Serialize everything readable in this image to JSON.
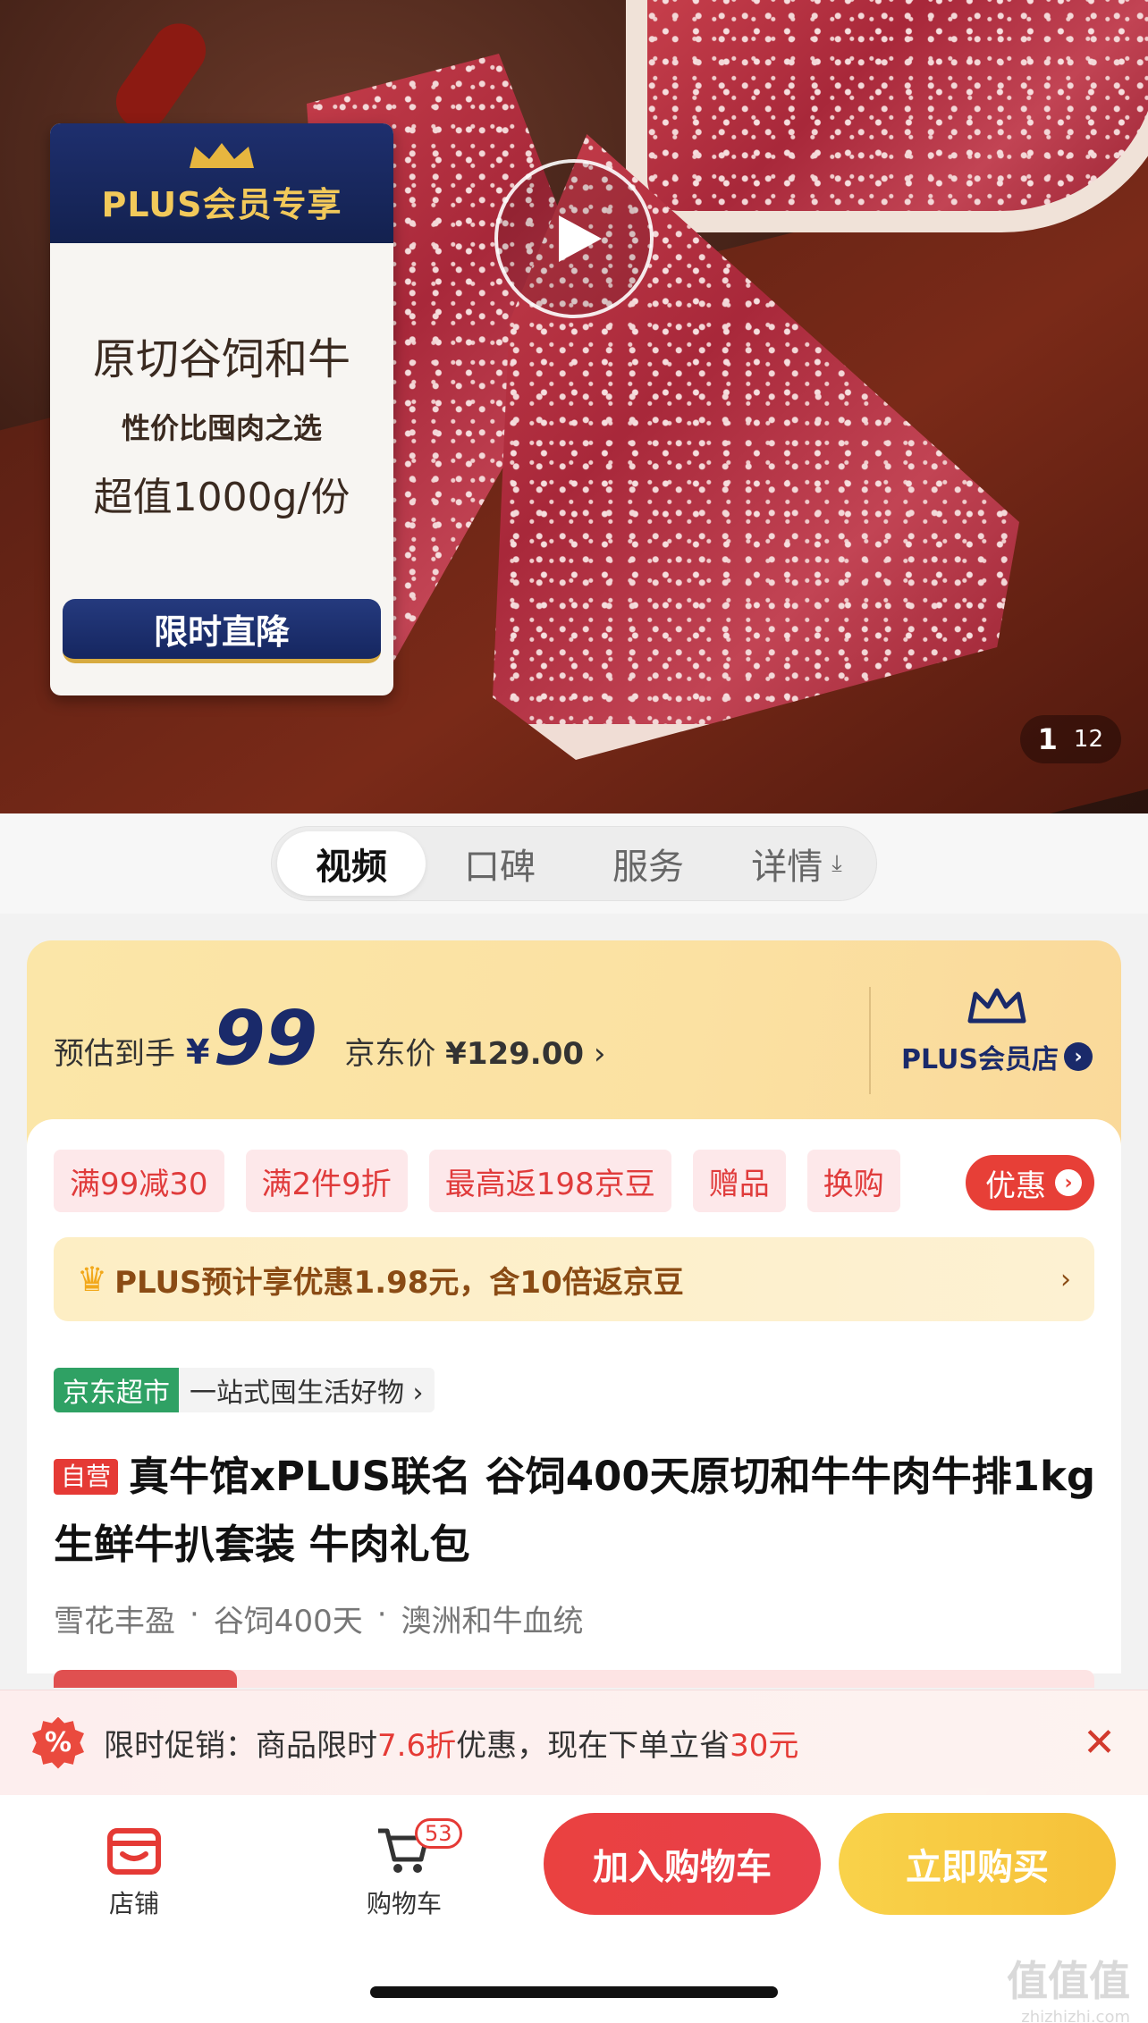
{
  "hero": {
    "promo_card": {
      "header": "PLUS会员专享",
      "title": "原切谷饲和牛",
      "subtitle": "性价比囤肉之选",
      "amount": "超值1000g/份",
      "button": "限时直降"
    },
    "counter": {
      "current": "1",
      "total": "12"
    }
  },
  "tabs": [
    {
      "label": "视频",
      "active": true
    },
    {
      "label": "口碑"
    },
    {
      "label": "服务"
    },
    {
      "label": "详情",
      "icon": "download-icon"
    }
  ],
  "price": {
    "estimate_label": "预估到手",
    "currency": "¥",
    "estimate_value": "99",
    "jd_label": "京东价",
    "jd_value": "¥129.00",
    "jd_chevron": "›",
    "plus_store": "PLUS会员店"
  },
  "tags": [
    "满99减30",
    "满2件9折",
    "最高返198京豆",
    "赠品",
    "换购"
  ],
  "youhui": "优惠",
  "plus_bar": {
    "text": "PLUS预计享优惠1.98元，含10倍返京豆",
    "chevron": "›"
  },
  "category": {
    "badge": "京东超市",
    "text": "一站式囤生活好物 ›"
  },
  "product": {
    "badge": "自营",
    "title": "真牛馆xPLUS联名 谷饲400天原切和牛牛肉牛排1kg 生鲜牛扒套装 牛肉礼包",
    "features": [
      "雪花丰盈",
      "谷饲400天",
      "澳洲和牛血统"
    ]
  },
  "promo_bar": {
    "icon": "%",
    "prefix": "限时促销：商品限时",
    "discount": "7.6",
    "mid1": "折",
    "mid2": "优惠，现在下单立省",
    "save": "30",
    "suffix": "元",
    "close": "✕"
  },
  "bottom": {
    "store": "店铺",
    "cart": "购物车",
    "cart_count": "53",
    "add_to_cart": "加入购物车",
    "buy_now": "立即购买"
  },
  "watermark": {
    "text": "值值值",
    "url": "zhizhizhi.com"
  },
  "colors": {
    "accent_red": "#e53a35",
    "plus_navy": "#1a2a6a",
    "gold": "#f6c139",
    "jd_green": "#2fa164"
  }
}
